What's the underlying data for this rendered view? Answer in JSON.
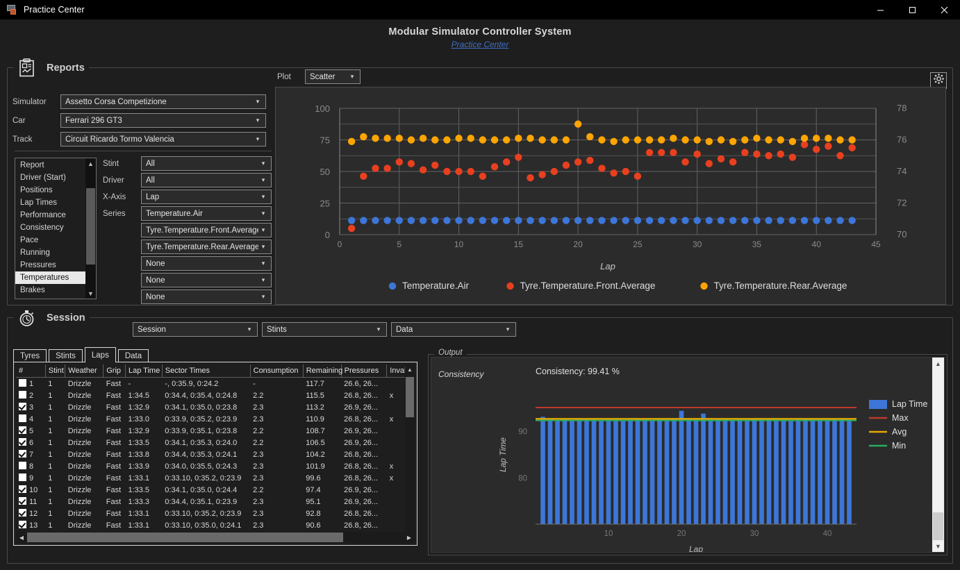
{
  "window": {
    "title": "Practice Center",
    "icon": "app-icon",
    "minimize": "—",
    "maximize": "□",
    "close": "✕"
  },
  "header": {
    "app_title": "Modular Simulator Controller System",
    "subtitle_link": "Practice Center"
  },
  "reports": {
    "section_label": "Reports",
    "icon": "clipboard-report-icon",
    "settings_icon": "gear-icon",
    "fields": [
      {
        "label": "Simulator",
        "value": "Assetto Corsa Competizione"
      },
      {
        "label": "Car",
        "value": "Ferrari 296 GT3"
      },
      {
        "label": "Track",
        "value": "Circuit Ricardo Tormo Valencia"
      }
    ],
    "report_list": [
      "Report",
      "Driver (Start)",
      "Positions",
      "Lap Times",
      "Performance",
      "Consistency",
      "Pace",
      "Running",
      "Pressures",
      "Temperatures",
      "Brakes"
    ],
    "report_selected": "Temperatures",
    "selectors": [
      {
        "label": "Stint",
        "value": "All"
      },
      {
        "label": "Driver",
        "value": "All"
      },
      {
        "label": "X-Axis",
        "value": "Lap"
      },
      {
        "label": "Series",
        "value": "Temperature.Air"
      },
      {
        "label": "",
        "value": "Tyre.Temperature.Front.Average"
      },
      {
        "label": "",
        "value": "Tyre.Temperature.Rear.Average"
      },
      {
        "label": "",
        "value": "None"
      },
      {
        "label": "",
        "value": "None"
      },
      {
        "label": "",
        "value": "None"
      }
    ],
    "plot_label": "Plot",
    "plot_type": "Scatter"
  },
  "chart_data": [
    {
      "type": "scatter",
      "title": "",
      "xlabel": "Lap",
      "ylabel": "",
      "xlim": [
        0,
        45
      ],
      "xticks": [
        0,
        5,
        10,
        15,
        20,
        25,
        30,
        35,
        40,
        45
      ],
      "ylim_left": [
        0,
        100
      ],
      "yticks_left": [
        0,
        25,
        50,
        75,
        100
      ],
      "ylim_right": [
        70,
        78
      ],
      "yticks_right": [
        70,
        72,
        74,
        76,
        78
      ],
      "grid": true,
      "legend_position": "bottom",
      "series": [
        {
          "name": "Temperature.Air",
          "color": "#3d76d8",
          "axis": "right",
          "x": [
            1,
            2,
            3,
            4,
            5,
            6,
            7,
            8,
            9,
            10,
            11,
            12,
            13,
            14,
            15,
            16,
            17,
            18,
            19,
            20,
            21,
            22,
            23,
            24,
            25,
            26,
            27,
            28,
            29,
            30,
            31,
            32,
            33,
            34,
            35,
            36,
            37,
            38,
            39,
            40,
            41,
            42,
            43
          ],
          "values": [
            70.9,
            70.9,
            70.9,
            70.9,
            70.9,
            70.9,
            70.9,
            70.9,
            70.9,
            70.9,
            70.9,
            70.9,
            70.9,
            70.9,
            70.9,
            70.9,
            70.9,
            70.9,
            70.9,
            70.9,
            70.9,
            70.9,
            70.9,
            70.9,
            70.9,
            70.9,
            70.9,
            70.9,
            70.9,
            70.9,
            70.9,
            70.9,
            70.9,
            70.9,
            70.9,
            70.9,
            70.9,
            70.9,
            70.9,
            70.9,
            70.9,
            70.9,
            70.9
          ]
        },
        {
          "name": "Tyre.Temperature.Front.Average",
          "color": "#e8401f",
          "axis": "right",
          "x": [
            1,
            2,
            3,
            4,
            5,
            6,
            7,
            8,
            9,
            10,
            11,
            12,
            13,
            14,
            15,
            16,
            17,
            18,
            19,
            20,
            21,
            22,
            23,
            24,
            25,
            26,
            27,
            28,
            29,
            30,
            31,
            32,
            33,
            34,
            35,
            36,
            37,
            38,
            39,
            40,
            41,
            42,
            43
          ],
          "values": [
            70.4,
            73.7,
            74.2,
            74.2,
            74.6,
            74.5,
            74.1,
            74.4,
            74.0,
            74.0,
            74.0,
            73.7,
            74.3,
            74.6,
            74.9,
            73.6,
            73.8,
            74.0,
            74.4,
            74.6,
            74.7,
            74.2,
            73.9,
            74.0,
            73.7,
            75.2,
            75.2,
            75.2,
            74.6,
            75.1,
            74.5,
            74.8,
            74.6,
            75.2,
            75.1,
            75.0,
            75.1,
            74.9,
            75.7,
            75.4,
            75.6,
            75.0,
            75.5
          ]
        },
        {
          "name": "Tyre.Temperature.Rear.Average",
          "color": "#ffa502",
          "axis": "right",
          "x": [
            1,
            2,
            3,
            4,
            5,
            6,
            7,
            8,
            9,
            10,
            11,
            12,
            13,
            14,
            15,
            16,
            17,
            18,
            19,
            20,
            21,
            22,
            23,
            24,
            25,
            26,
            27,
            28,
            29,
            30,
            31,
            32,
            33,
            34,
            35,
            36,
            37,
            38,
            39,
            40,
            41,
            42,
            43
          ],
          "values": [
            75.9,
            76.2,
            76.1,
            76.1,
            76.1,
            76.0,
            76.1,
            76.0,
            76.0,
            76.1,
            76.1,
            76.0,
            76.0,
            76.0,
            76.1,
            76.1,
            76.0,
            76.0,
            76.0,
            77.0,
            76.2,
            76.0,
            75.9,
            76.0,
            76.0,
            76.0,
            76.0,
            76.1,
            76.0,
            76.0,
            75.9,
            76.0,
            75.9,
            76.0,
            76.1,
            76.0,
            76.0,
            75.9,
            76.1,
            76.1,
            76.1,
            76.0,
            76.0
          ]
        }
      ]
    },
    {
      "type": "bar",
      "title": "Consistency: 99.41 %",
      "xlabel": "Lap",
      "ylabel": "Lap Time",
      "xticks": [
        10,
        20,
        30,
        40
      ],
      "yticks": [
        80,
        90
      ],
      "ylim": [
        70,
        100
      ],
      "xlim": [
        0,
        44
      ],
      "grid": false,
      "legend_position": "right",
      "legend": [
        {
          "name": "Lap Time",
          "color": "#3d76d8",
          "marker": "bar"
        },
        {
          "name": "Max",
          "color": "#c0392b",
          "marker": "line"
        },
        {
          "name": "Avg",
          "color": "#e6a800",
          "marker": "line"
        },
        {
          "name": "Min",
          "color": "#27ae60",
          "marker": "line"
        }
      ],
      "categories": [
        1,
        2,
        3,
        4,
        5,
        6,
        7,
        8,
        9,
        10,
        11,
        12,
        13,
        14,
        15,
        16,
        17,
        18,
        19,
        20,
        21,
        22,
        23,
        24,
        25,
        26,
        27,
        28,
        29,
        30,
        31,
        32,
        33,
        34,
        35,
        36,
        37,
        38,
        39,
        40,
        41,
        42,
        43
      ],
      "values": [
        93.2,
        92.7,
        92.5,
        92.8,
        92.5,
        92.6,
        92.7,
        92.6,
        92.5,
        92.7,
        92.6,
        92.5,
        92.6,
        92.9,
        92.6,
        92.5,
        92.6,
        92.7,
        92.8,
        94.5,
        92.7,
        92.6,
        93.9,
        92.6,
        92.6,
        92.7,
        92.5,
        92.6,
        92.7,
        92.6,
        92.6,
        92.8,
        92.6,
        92.7,
        92.5,
        92.6,
        92.7,
        92.6,
        92.6,
        92.7,
        92.6,
        92.7,
        92.8
      ],
      "max_line": 95.2,
      "avg_line": 92.75,
      "min_line": 92.4
    }
  ],
  "session": {
    "section_label": "Session",
    "icon": "stopwatch-icon",
    "dropdowns": [
      {
        "value": "Session"
      },
      {
        "value": "Stints"
      },
      {
        "value": "Data"
      }
    ],
    "tabs": [
      {
        "label": "Tyres",
        "active": false
      },
      {
        "label": "Stints",
        "active": false
      },
      {
        "label": "Laps",
        "active": true
      },
      {
        "label": "Data",
        "active": false
      }
    ],
    "table": {
      "columns": [
        "#",
        "Stint",
        "Weather",
        "Grip",
        "Lap Time",
        "Sector Times",
        "Consumption",
        "Remaining",
        "Pressures",
        "Inval"
      ],
      "rows": [
        {
          "checked": false,
          "num": "1",
          "stint": "1",
          "weather": "Drizzle",
          "grip": "Fast",
          "lap": "-",
          "sectors": "-, 0:35.9, 0:24.2",
          "cons": "-",
          "rem": "117.7",
          "press": "26.6, 26...",
          "inval": ""
        },
        {
          "checked": false,
          "num": "2",
          "stint": "1",
          "weather": "Drizzle",
          "grip": "Fast",
          "lap": "1:34.5",
          "sectors": "0:34.4, 0:35.4, 0:24.8",
          "cons": "2.2",
          "rem": "115.5",
          "press": "26.8, 26...",
          "inval": "x"
        },
        {
          "checked": true,
          "num": "3",
          "stint": "1",
          "weather": "Drizzle",
          "grip": "Fast",
          "lap": "1:32.9",
          "sectors": "0:34.1, 0:35.0, 0:23.8",
          "cons": "2.3",
          "rem": "113.2",
          "press": "26.9, 26...",
          "inval": ""
        },
        {
          "checked": false,
          "num": "4",
          "stint": "1",
          "weather": "Drizzle",
          "grip": "Fast",
          "lap": "1:33.0",
          "sectors": "0:33.9, 0:35.2, 0:23.9",
          "cons": "2.3",
          "rem": "110.9",
          "press": "26.8, 26...",
          "inval": "x"
        },
        {
          "checked": true,
          "num": "5",
          "stint": "1",
          "weather": "Drizzle",
          "grip": "Fast",
          "lap": "1:32.9",
          "sectors": "0:33.9, 0:35.1, 0:23.8",
          "cons": "2.2",
          "rem": "108.7",
          "press": "26.9, 26...",
          "inval": ""
        },
        {
          "checked": true,
          "num": "6",
          "stint": "1",
          "weather": "Drizzle",
          "grip": "Fast",
          "lap": "1:33.5",
          "sectors": "0:34.1, 0:35.3, 0:24.0",
          "cons": "2.2",
          "rem": "106.5",
          "press": "26.9, 26...",
          "inval": ""
        },
        {
          "checked": true,
          "num": "7",
          "stint": "1",
          "weather": "Drizzle",
          "grip": "Fast",
          "lap": "1:33.8",
          "sectors": "0:34.4, 0:35.3, 0:24.1",
          "cons": "2.3",
          "rem": "104.2",
          "press": "26.8, 26...",
          "inval": ""
        },
        {
          "checked": false,
          "num": "8",
          "stint": "1",
          "weather": "Drizzle",
          "grip": "Fast",
          "lap": "1:33.9",
          "sectors": "0:34.0, 0:35.5, 0:24.3",
          "cons": "2.3",
          "rem": "101.9",
          "press": "26.8, 26...",
          "inval": "x"
        },
        {
          "checked": false,
          "num": "9",
          "stint": "1",
          "weather": "Drizzle",
          "grip": "Fast",
          "lap": "1:33.1",
          "sectors": "0:33.10, 0:35.2, 0:23.9",
          "cons": "2.3",
          "rem": "99.6",
          "press": "26.8, 26...",
          "inval": "x"
        },
        {
          "checked": true,
          "num": "10",
          "stint": "1",
          "weather": "Drizzle",
          "grip": "Fast",
          "lap": "1:33.5",
          "sectors": "0:34.1, 0:35.0, 0:24.4",
          "cons": "2.2",
          "rem": "97.4",
          "press": "26.9, 26...",
          "inval": ""
        },
        {
          "checked": true,
          "num": "11",
          "stint": "1",
          "weather": "Drizzle",
          "grip": "Fast",
          "lap": "1:33.3",
          "sectors": "0:34.4, 0:35.1, 0:23.9",
          "cons": "2.3",
          "rem": "95.1",
          "press": "26.9, 26...",
          "inval": ""
        },
        {
          "checked": true,
          "num": "12",
          "stint": "1",
          "weather": "Drizzle",
          "grip": "Fast",
          "lap": "1:33.1",
          "sectors": "0:33.10, 0:35.2, 0:23.9",
          "cons": "2.3",
          "rem": "92.8",
          "press": "26.8, 26...",
          "inval": ""
        },
        {
          "checked": true,
          "num": "13",
          "stint": "1",
          "weather": "Drizzle",
          "grip": "Fast",
          "lap": "1:33.1",
          "sectors": "0:33.10, 0:35.0, 0:24.1",
          "cons": "2.3",
          "rem": "90.6",
          "press": "26.8, 26...",
          "inval": ""
        }
      ]
    },
    "output_label": "Output",
    "output_title": "Consistency"
  }
}
